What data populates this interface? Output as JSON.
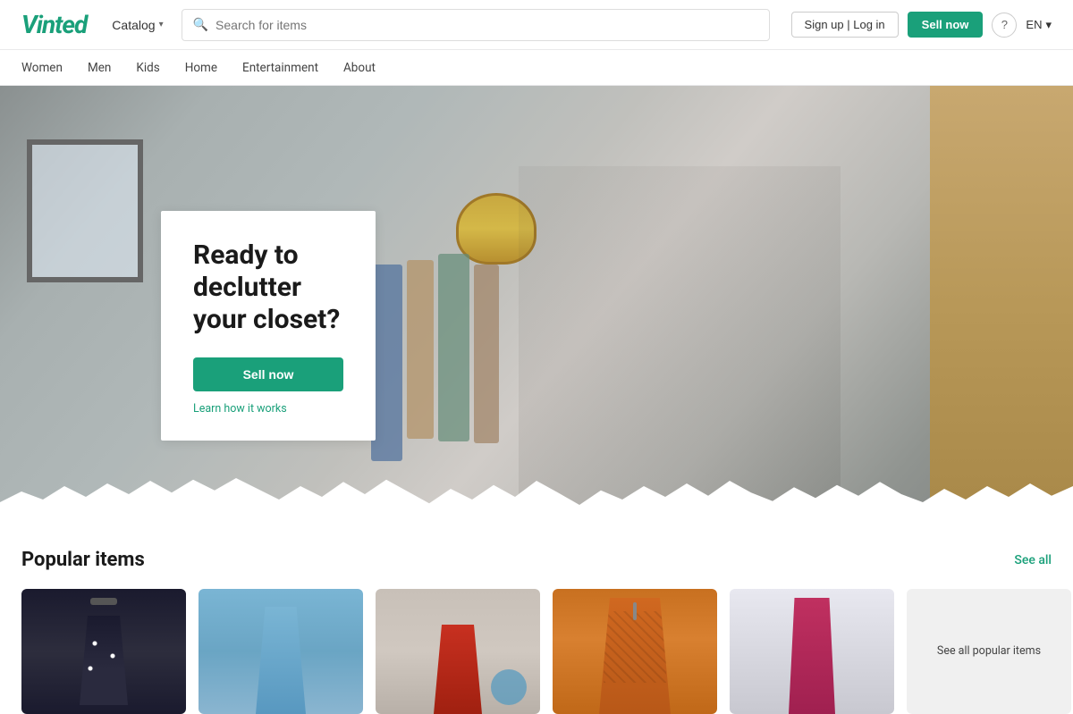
{
  "header": {
    "logo": "Vinted",
    "catalog_label": "Catalog",
    "search_placeholder": "Search for items",
    "sign_label": "Sign up | Log in",
    "sell_label": "Sell now",
    "help_label": "?",
    "lang_label": "EN"
  },
  "nav": {
    "items": [
      {
        "label": "Women",
        "id": "women"
      },
      {
        "label": "Men",
        "id": "men"
      },
      {
        "label": "Kids",
        "id": "kids"
      },
      {
        "label": "Home",
        "id": "home"
      },
      {
        "label": "Entertainment",
        "id": "entertainment"
      },
      {
        "label": "About",
        "id": "about"
      }
    ]
  },
  "hero": {
    "title": "Ready to declutter your closet?",
    "sell_label": "Sell now",
    "learn_label": "Learn how it works"
  },
  "popular": {
    "title": "Popular items",
    "see_all_label": "See all",
    "see_all_items_label": "See all popular items"
  }
}
